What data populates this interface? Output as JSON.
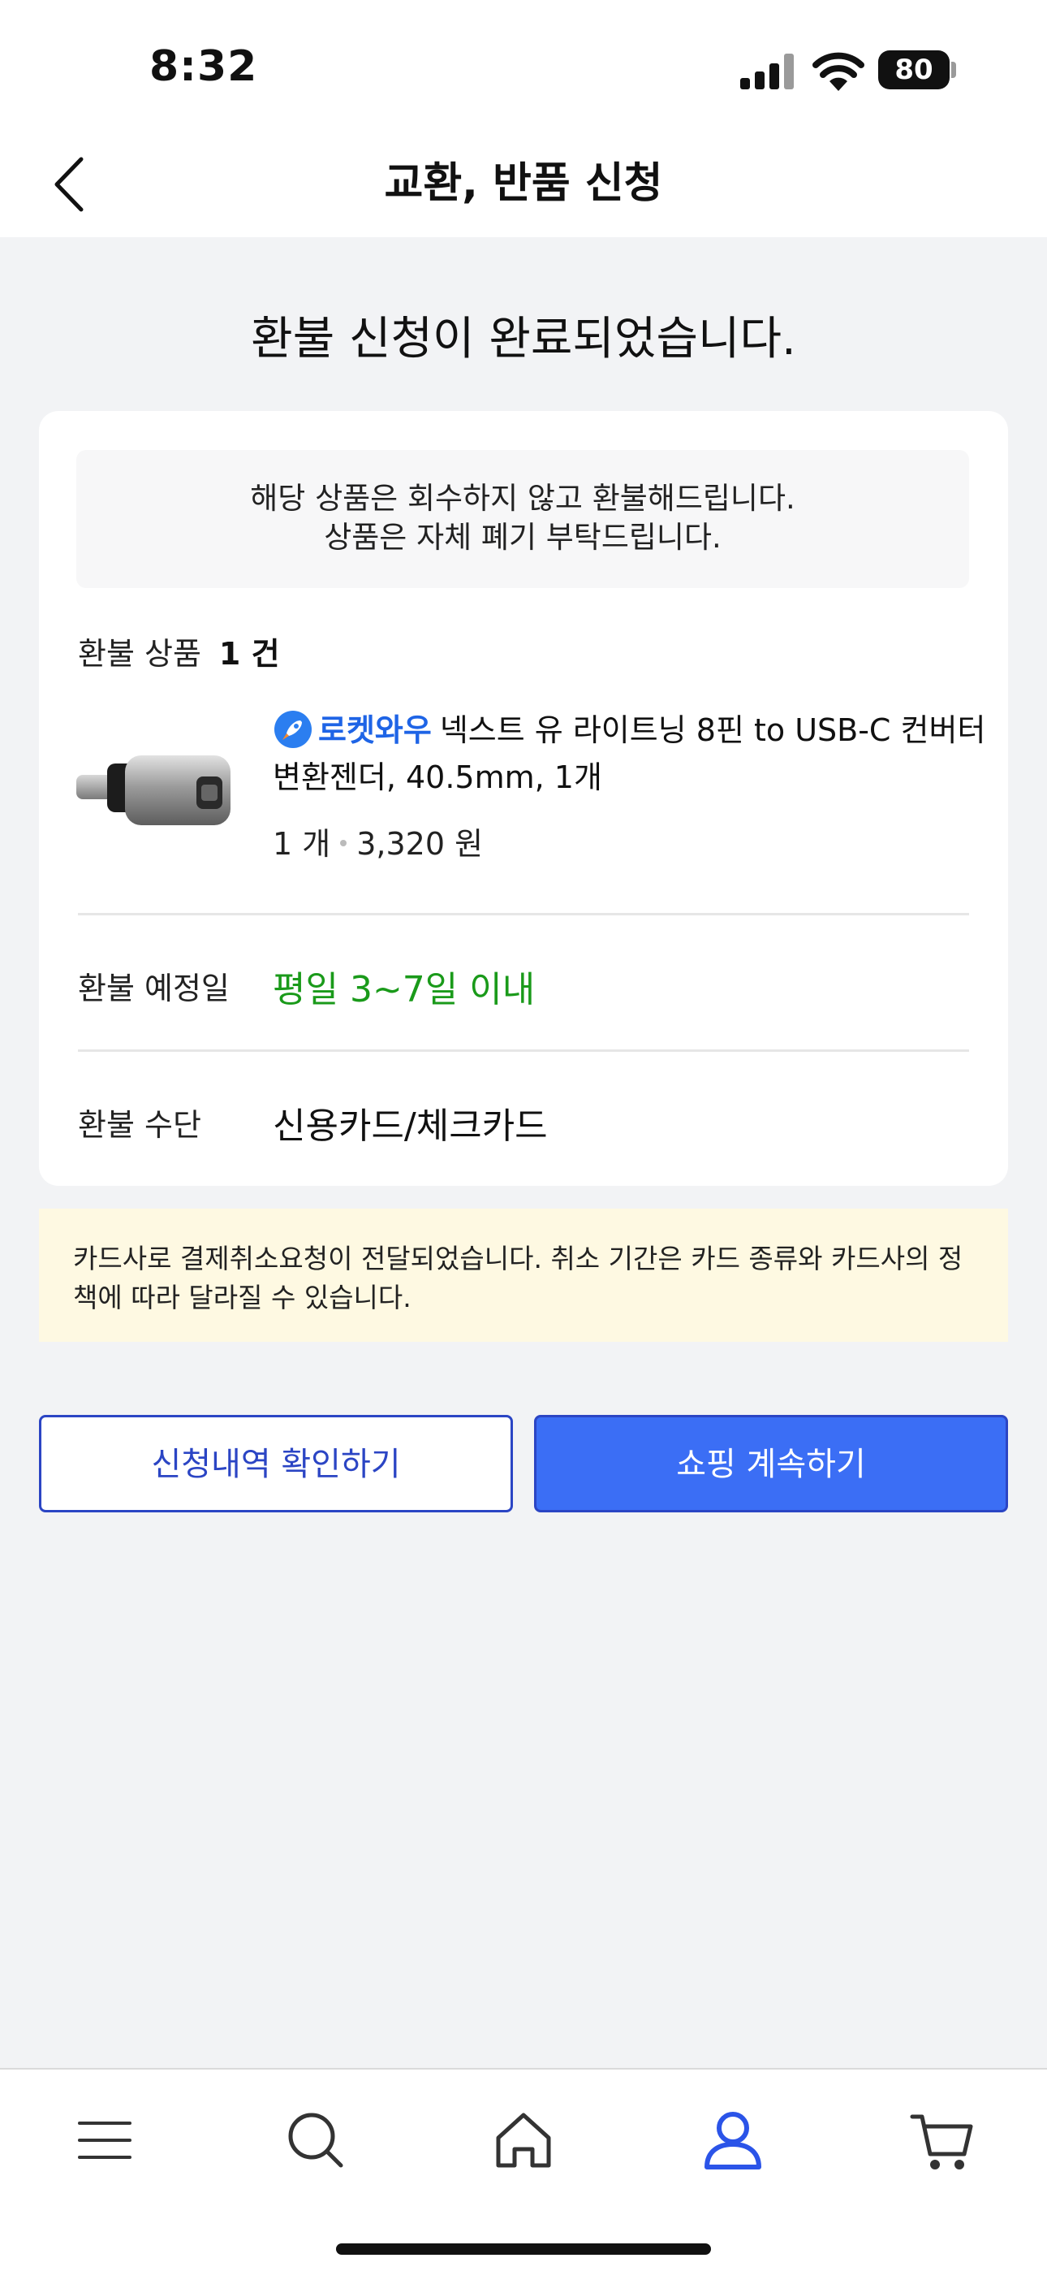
{
  "status_bar": {
    "time": "8:32",
    "battery": "80"
  },
  "header": {
    "title": "교환, 반품 신청"
  },
  "headline": "환불 신청이 완료되었습니다.",
  "notice": {
    "line1": "해당 상품은 회수하지 않고 환불해드립니다.",
    "line2": "상품은 자체 폐기 부탁드립니다."
  },
  "refund_items": {
    "label": "환불 상품",
    "count": "1 건"
  },
  "product": {
    "badge": "로켓와우",
    "name": "넥스트 유 라이트닝 8핀 to USB-C 컨버터 변환젠더, 40.5mm, 1개",
    "quantity": "1 개",
    "price": "3,320 원"
  },
  "refund_date": {
    "label": "환불 예정일",
    "value": "평일 3~7일 이내",
    "color": "#1a9a1a"
  },
  "refund_method": {
    "label": "환불 수단",
    "value": "신용카드/체크카드"
  },
  "card_notice": "카드사로 결제취소요청이 전달되었습니다. 취소 기간은 카드 종류와 카드사의 정책에 따라 달라질 수 있습니다.",
  "buttons": {
    "check_history": "신청내역 확인하기",
    "continue_shopping": "쇼핑 계속하기"
  },
  "tab_bar": {
    "items": [
      {
        "icon": "menu-icon",
        "active": false
      },
      {
        "icon": "search-icon",
        "active": false
      },
      {
        "icon": "home-icon",
        "active": false
      },
      {
        "icon": "user-icon",
        "active": true
      },
      {
        "icon": "cart-icon",
        "active": false
      }
    ],
    "active_color": "#2b54e8"
  }
}
